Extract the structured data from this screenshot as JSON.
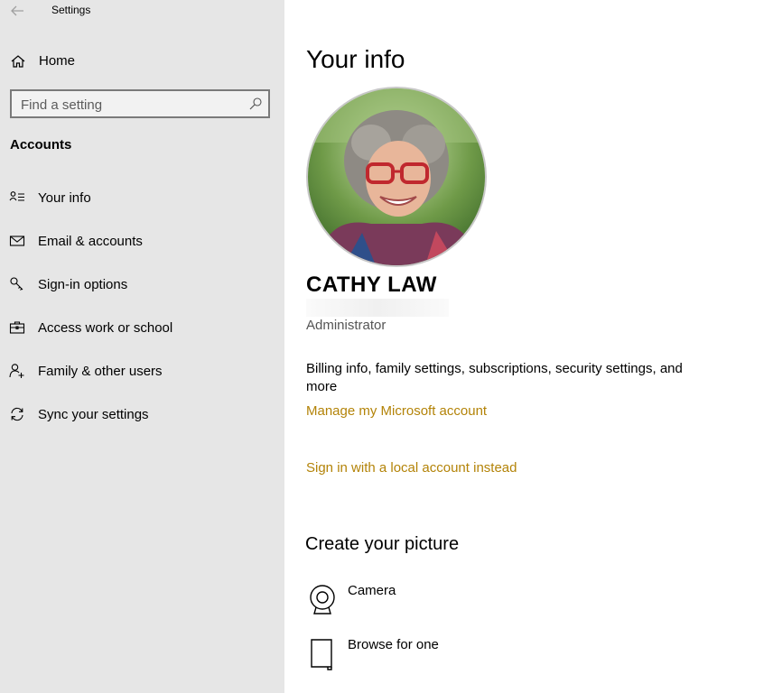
{
  "window": {
    "title": "Settings"
  },
  "sidebar": {
    "home_label": "Home",
    "search": {
      "placeholder": "Find a setting",
      "value": ""
    },
    "section_title": "Accounts",
    "items": [
      {
        "label": "Your info",
        "icon": "person-list-icon"
      },
      {
        "label": "Email & accounts",
        "icon": "mail-icon"
      },
      {
        "label": "Sign-in options",
        "icon": "key-icon"
      },
      {
        "label": "Access work or school",
        "icon": "briefcase-icon"
      },
      {
        "label": "Family & other users",
        "icon": "person-add-icon"
      },
      {
        "label": "Sync your settings",
        "icon": "sync-icon"
      }
    ]
  },
  "main": {
    "title": "Your info",
    "user_name": "CATHY LAW",
    "role": "Administrator",
    "billing_text": "Billing info, family settings, subscriptions, security settings, and more",
    "manage_link": "Manage my Microsoft account",
    "local_account_link": "Sign in with a local account instead",
    "create_picture_title": "Create your picture",
    "picture_options": [
      {
        "label": "Camera",
        "icon": "camera-icon"
      },
      {
        "label": "Browse for one",
        "icon": "document-icon"
      }
    ]
  },
  "colors": {
    "accent_link": "#b38308",
    "sidebar_bg": "#e6e6e6"
  }
}
